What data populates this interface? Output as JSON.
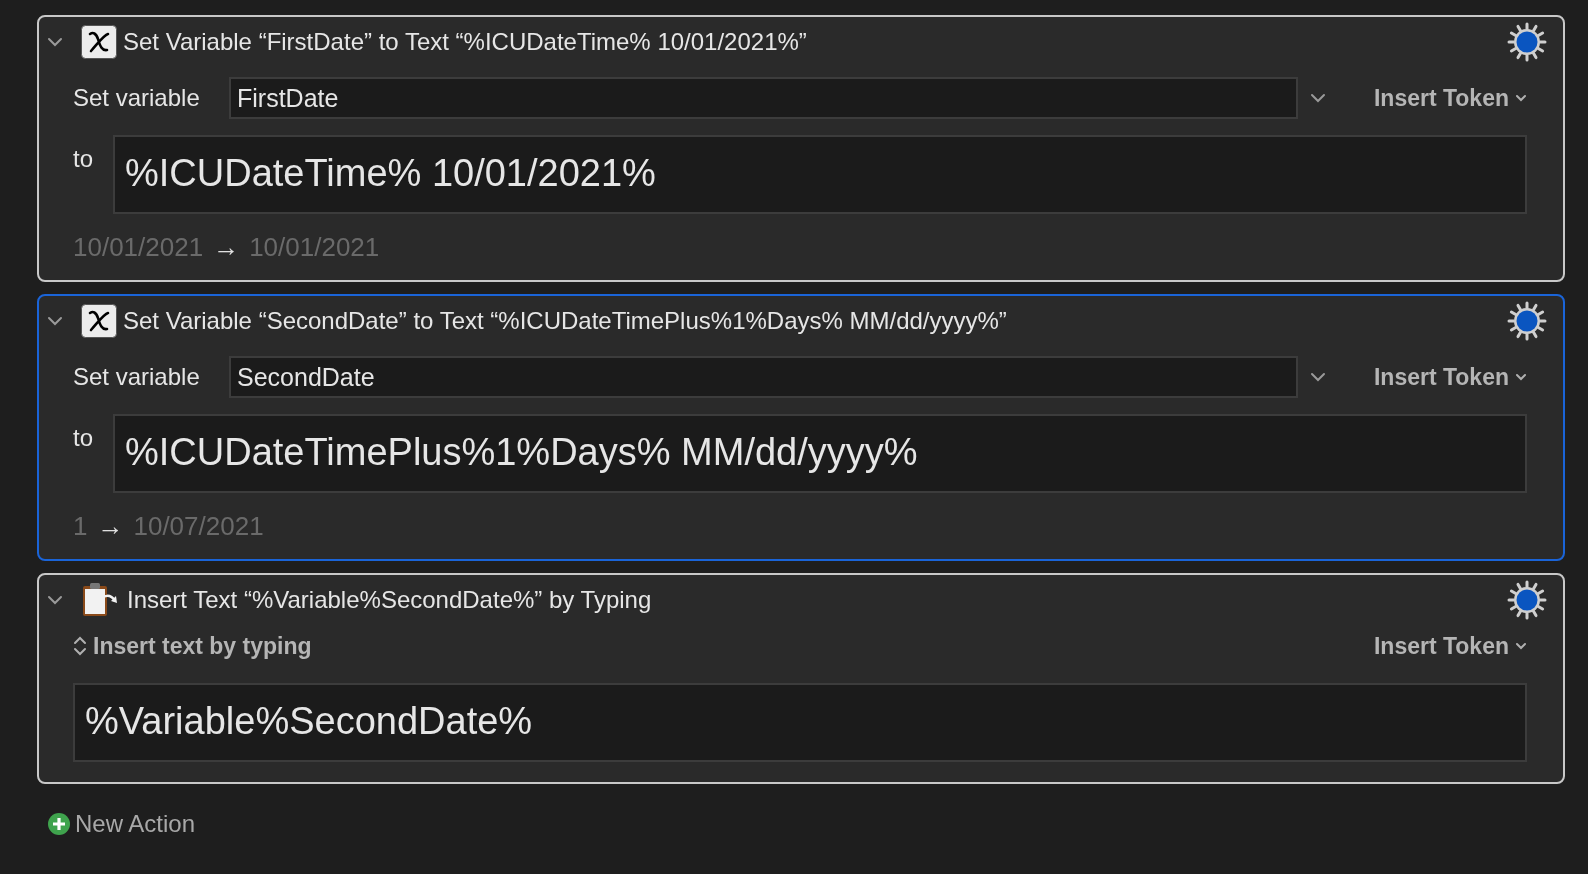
{
  "actions": [
    {
      "kind": "set_variable",
      "expanded": true,
      "selected": false,
      "title": "Set Variable “FirstDate” to Text “%ICUDateTime% 10/01/2021%”",
      "label": "Set variable",
      "variable": "FirstDate",
      "insert_token": "Insert Token",
      "to_label": "to",
      "text": "%ICUDateTime% 10/01/2021%",
      "preview": {
        "input": "10/01/2021",
        "arrow": "→",
        "output": "10/01/2021"
      }
    },
    {
      "kind": "set_variable",
      "expanded": true,
      "selected": true,
      "title": "Set Variable “SecondDate” to Text “%ICUDateTimePlus%1%Days% MM/dd/yyyy%”",
      "label": "Set variable",
      "variable": "SecondDate",
      "insert_token": "Insert Token",
      "to_label": "to",
      "text": "%ICUDateTimePlus%1%Days% MM/dd/yyyy%",
      "preview": {
        "input": "1",
        "arrow": "→",
        "output": "10/07/2021"
      }
    },
    {
      "kind": "insert_text",
      "expanded": true,
      "selected": false,
      "title": "Insert Text “%Variable%SecondDate%” by Typing",
      "mode": "Insert text by typing",
      "insert_token": "Insert Token",
      "text": "%Variable%SecondDate%"
    }
  ],
  "new_action": "New Action"
}
